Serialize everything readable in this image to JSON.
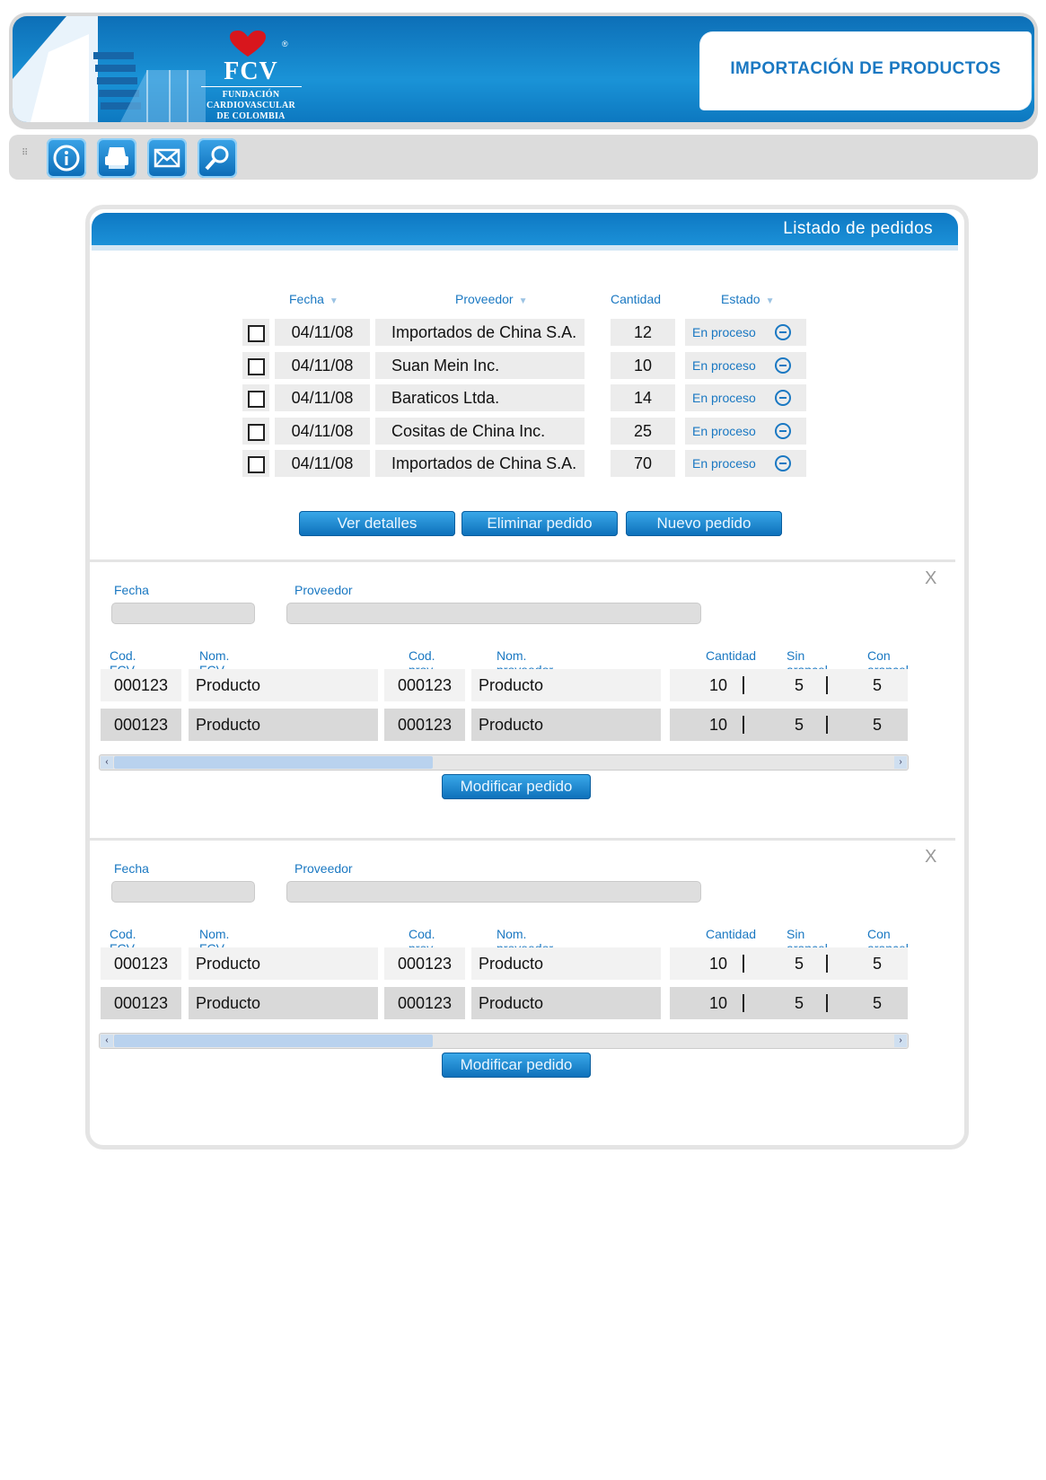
{
  "header": {
    "logo_abbr": "FCV",
    "logo_lines": [
      "FUNDACIÓN",
      "CARDIOVASCULAR",
      "DE COLOMBIA"
    ],
    "registered": "®",
    "page_title": "IMPORTACIÓN DE PRODUCTOS"
  },
  "toolbar": {
    "grip": "⠿",
    "buttons": [
      "info-icon",
      "print-icon",
      "mail-icon",
      "search-icon"
    ]
  },
  "panel": {
    "title": "Listado de pedidos",
    "orders": {
      "headers": {
        "fecha": "Fecha",
        "proveedor": "Proveedor",
        "cantidad": "Cantidad",
        "estado": "Estado"
      },
      "sort_glyph": "▼",
      "rows": [
        {
          "fecha": "04/11/08",
          "proveedor": "Importados de China S.A.",
          "cantidad": "12",
          "estado": "En proceso"
        },
        {
          "fecha": "04/11/08",
          "proveedor": "Suan Mein Inc.",
          "cantidad": "10",
          "estado": "En proceso"
        },
        {
          "fecha": "04/11/08",
          "proveedor": "Baraticos Ltda.",
          "cantidad": "14",
          "estado": "En proceso"
        },
        {
          "fecha": "04/11/08",
          "proveedor": "Cositas de China Inc.",
          "cantidad": "25",
          "estado": "En proceso"
        },
        {
          "fecha": "04/11/08",
          "proveedor": "Importados de China S.A.",
          "cantidad": "70",
          "estado": "En proceso"
        }
      ],
      "buttons": {
        "ver": "Ver detalles",
        "eliminar": "Eliminar pedido",
        "nuevo": "Nuevo pedido"
      }
    },
    "details": [
      {
        "close": "X",
        "fecha_label": "Fecha",
        "proveedor_label": "Proveedor",
        "headers": {
          "cod_fcv": "Cod. FCV",
          "nom_fcv": "Nom. FCV",
          "cod_prov": "Cod. prov.",
          "nom_prov": "Nom. proveedor",
          "cantidad": "Cantidad",
          "sin": "Sin arancel",
          "con": "Con arancel"
        },
        "rows": [
          {
            "cod_fcv": "000123",
            "nom_fcv": "Producto",
            "cod_prov": "000123",
            "nom_prov": "Producto",
            "cantidad": "10",
            "sin": "5",
            "con": "5"
          },
          {
            "cod_fcv": "000123",
            "nom_fcv": "Producto",
            "cod_prov": "000123",
            "nom_prov": "Producto",
            "cantidad": "10",
            "sin": "5",
            "con": "5"
          }
        ],
        "button": "Modificar pedido"
      },
      {
        "close": "X",
        "fecha_label": "Fecha",
        "proveedor_label": "Proveedor",
        "headers": {
          "cod_fcv": "Cod. FCV",
          "nom_fcv": "Nom. FCV",
          "cod_prov": "Cod. prov.",
          "nom_prov": "Nom. proveedor",
          "cantidad": "Cantidad",
          "sin": "Sin arancel",
          "con": "Con arancel"
        },
        "rows": [
          {
            "cod_fcv": "000123",
            "nom_fcv": "Producto",
            "cod_prov": "000123",
            "nom_prov": "Producto",
            "cantidad": "10",
            "sin": "5",
            "con": "5"
          },
          {
            "cod_fcv": "000123",
            "nom_fcv": "Producto",
            "cod_prov": "000123",
            "nom_prov": "Producto",
            "cantidad": "10",
            "sin": "5",
            "con": "5"
          }
        ],
        "button": "Modificar pedido"
      }
    ]
  },
  "scroll": {
    "left": "‹",
    "right": "›"
  }
}
